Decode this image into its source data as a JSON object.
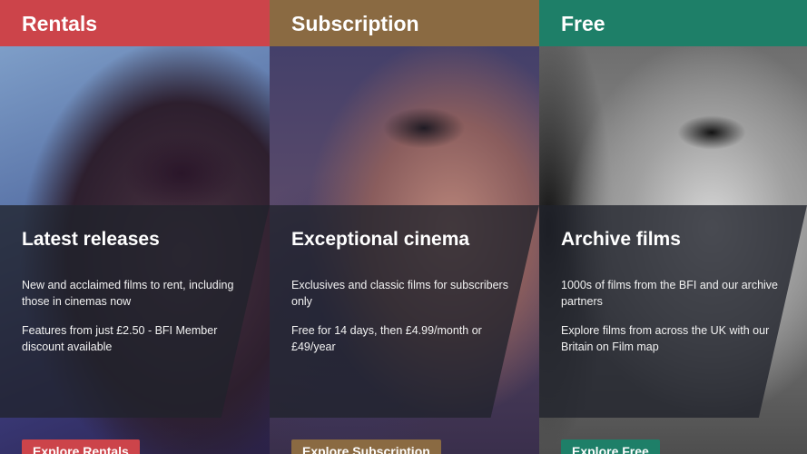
{
  "columns": [
    {
      "header": "Rentals",
      "title": "Latest releases",
      "desc1": "New and acclaimed films to rent, including those in cinemas now",
      "desc2": "Features from just £2.50 - BFI Member discount available",
      "button": "Explore Rentals",
      "accent": "#cc444a"
    },
    {
      "header": "Subscription",
      "title": "Exceptional cinema",
      "desc1": "Exclusives and classic films for subscribers only",
      "desc2": "Free for 14 days, then £4.99/month or £49/year",
      "button": "Explore Subscription",
      "accent": "#8a6a42"
    },
    {
      "header": "Free",
      "title": "Archive films",
      "desc1": "1000s of films from the BFI and our archive partners",
      "desc2": "Explore films from across the UK with our Britain on Film map",
      "button": "Explore Free",
      "accent": "#1e7f68"
    }
  ]
}
